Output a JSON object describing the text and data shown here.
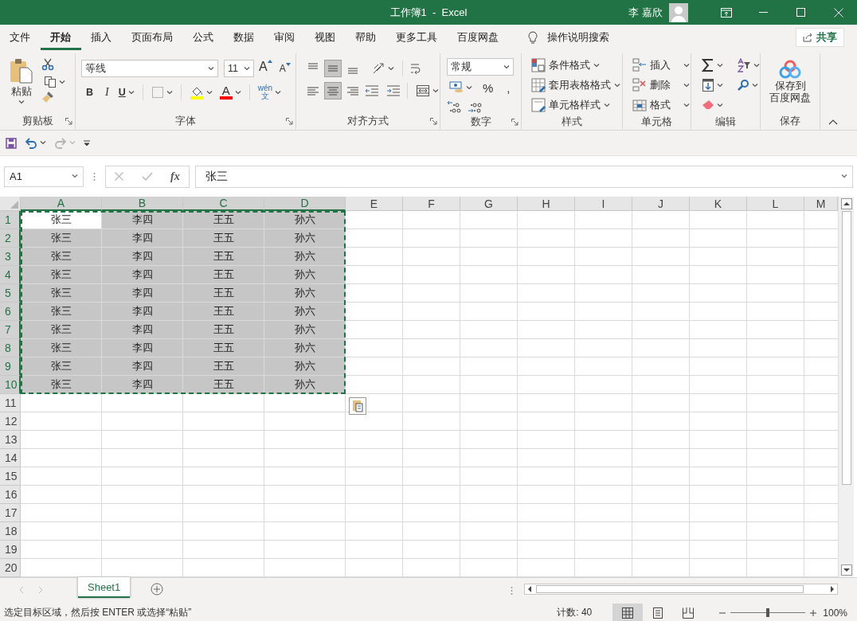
{
  "window": {
    "title": "工作簿1  -  Excel",
    "user": "李 嘉欣"
  },
  "ribbon_tabs": [
    {
      "label": "文件",
      "selected": false
    },
    {
      "label": "开始",
      "selected": true
    },
    {
      "label": "插入",
      "selected": false
    },
    {
      "label": "页面布局",
      "selected": false
    },
    {
      "label": "公式",
      "selected": false
    },
    {
      "label": "数据",
      "selected": false
    },
    {
      "label": "审阅",
      "selected": false
    },
    {
      "label": "视图",
      "selected": false
    },
    {
      "label": "帮助",
      "selected": false
    },
    {
      "label": "更多工具",
      "selected": false
    },
    {
      "label": "百度网盘",
      "selected": false
    }
  ],
  "tell_me": "操作说明搜索",
  "share": "共享",
  "ribbon": {
    "groups": [
      {
        "kind": "clipboard",
        "label": "剪贴板",
        "launcher": true,
        "paste": "粘贴"
      },
      {
        "kind": "font",
        "label": "字体",
        "launcher": true,
        "font_name": "等线",
        "font_size": "11",
        "grow": "A",
        "shrink": "A",
        "bold": "B",
        "italic": "I",
        "underline": "U",
        "font_color": "A",
        "phonetic": [
          "wén",
          "文"
        ]
      },
      {
        "kind": "alignment",
        "label": "对齐方式",
        "launcher": true,
        "vertical": [
          {
            "kind": "top",
            "selected": false
          },
          {
            "kind": "middle",
            "selected": true
          },
          {
            "kind": "bottom",
            "selected": false
          }
        ],
        "horizontal": [
          {
            "kind": "left",
            "selected": false
          },
          {
            "kind": "center",
            "selected": true
          },
          {
            "kind": "right",
            "selected": false
          }
        ]
      },
      {
        "kind": "number",
        "label": "数字",
        "launcher": true,
        "format": "常规",
        "percent": "%",
        "comma": ","
      },
      {
        "kind": "styles",
        "label": "样式",
        "launcher": false,
        "items": [
          "条件格式",
          "套用表格格式",
          "单元格样式"
        ]
      },
      {
        "kind": "cells",
        "label": "单元格",
        "launcher": false,
        "items": [
          "插入",
          "删除",
          "格式"
        ]
      },
      {
        "kind": "editing",
        "label": "编辑",
        "launcher": false
      },
      {
        "kind": "save",
        "label": "保存",
        "launcher": false,
        "button": [
          "保存到",
          "百度网盘"
        ]
      }
    ]
  },
  "quick_access": {
    "redo_disabled": true
  },
  "formula_bar": {
    "name_box": "A1",
    "fx": "fx",
    "formula": "张三"
  },
  "sheet": {
    "columns": [
      {
        "label": "A",
        "selected": true
      },
      {
        "label": "B",
        "selected": true
      },
      {
        "label": "C",
        "selected": true
      },
      {
        "label": "D",
        "selected": true
      },
      {
        "label": "E",
        "selected": false
      },
      {
        "label": "F",
        "selected": false
      },
      {
        "label": "G",
        "selected": false
      },
      {
        "label": "H",
        "selected": false
      },
      {
        "label": "I",
        "selected": false
      },
      {
        "label": "J",
        "selected": false
      },
      {
        "label": "K",
        "selected": false
      },
      {
        "label": "L",
        "selected": false
      },
      {
        "label": "M",
        "selected": false
      }
    ],
    "rows": [
      {
        "label": "1",
        "selected": true,
        "cells": [
          {
            "text": "张三",
            "active": true
          },
          {
            "text": "李四",
            "active": false
          },
          {
            "text": "王五",
            "active": false
          },
          {
            "text": "孙六",
            "active": false
          }
        ]
      },
      {
        "label": "2",
        "selected": true,
        "cells": [
          {
            "text": "张三",
            "active": false
          },
          {
            "text": "李四",
            "active": false
          },
          {
            "text": "王五",
            "active": false
          },
          {
            "text": "孙六",
            "active": false
          }
        ]
      },
      {
        "label": "3",
        "selected": true,
        "cells": [
          {
            "text": "张三",
            "active": false
          },
          {
            "text": "李四",
            "active": false
          },
          {
            "text": "王五",
            "active": false
          },
          {
            "text": "孙六",
            "active": false
          }
        ]
      },
      {
        "label": "4",
        "selected": true,
        "cells": [
          {
            "text": "张三",
            "active": false
          },
          {
            "text": "李四",
            "active": false
          },
          {
            "text": "王五",
            "active": false
          },
          {
            "text": "孙六",
            "active": false
          }
        ]
      },
      {
        "label": "5",
        "selected": true,
        "cells": [
          {
            "text": "张三",
            "active": false
          },
          {
            "text": "李四",
            "active": false
          },
          {
            "text": "王五",
            "active": false
          },
          {
            "text": "孙六",
            "active": false
          }
        ]
      },
      {
        "label": "6",
        "selected": true,
        "cells": [
          {
            "text": "张三",
            "active": false
          },
          {
            "text": "李四",
            "active": false
          },
          {
            "text": "王五",
            "active": false
          },
          {
            "text": "孙六",
            "active": false
          }
        ]
      },
      {
        "label": "7",
        "selected": true,
        "cells": [
          {
            "text": "张三",
            "active": false
          },
          {
            "text": "李四",
            "active": false
          },
          {
            "text": "王五",
            "active": false
          },
          {
            "text": "孙六",
            "active": false
          }
        ]
      },
      {
        "label": "8",
        "selected": true,
        "cells": [
          {
            "text": "张三",
            "active": false
          },
          {
            "text": "李四",
            "active": false
          },
          {
            "text": "王五",
            "active": false
          },
          {
            "text": "孙六",
            "active": false
          }
        ]
      },
      {
        "label": "9",
        "selected": true,
        "cells": [
          {
            "text": "张三",
            "active": false
          },
          {
            "text": "李四",
            "active": false
          },
          {
            "text": "王五",
            "active": false
          },
          {
            "text": "孙六",
            "active": false
          }
        ]
      },
      {
        "label": "10",
        "selected": true,
        "cells": [
          {
            "text": "张三",
            "active": false
          },
          {
            "text": "李四",
            "active": false
          },
          {
            "text": "王五",
            "active": false
          },
          {
            "text": "孙六",
            "active": false
          }
        ]
      },
      {
        "label": "11",
        "selected": false
      },
      {
        "label": "12",
        "selected": false
      },
      {
        "label": "13",
        "selected": false
      },
      {
        "label": "14",
        "selected": false
      },
      {
        "label": "15",
        "selected": false
      },
      {
        "label": "16",
        "selected": false
      },
      {
        "label": "17",
        "selected": false
      },
      {
        "label": "18",
        "selected": false
      },
      {
        "label": "19",
        "selected": false
      },
      {
        "label": "20",
        "selected": false
      }
    ]
  },
  "sheet_tabs": [
    {
      "label": "Sheet1",
      "selected": true
    }
  ],
  "status_bar": {
    "message": "选定目标区域，然后按 ENTER 或选择“粘贴”",
    "count": "计数: 40",
    "views": [
      {
        "kind": "normal",
        "selected": true
      },
      {
        "kind": "page_layout",
        "selected": false
      },
      {
        "kind": "page_break",
        "selected": false
      }
    ],
    "zoom_slider": {
      "level": 0.5
    },
    "zoom": "100%"
  }
}
